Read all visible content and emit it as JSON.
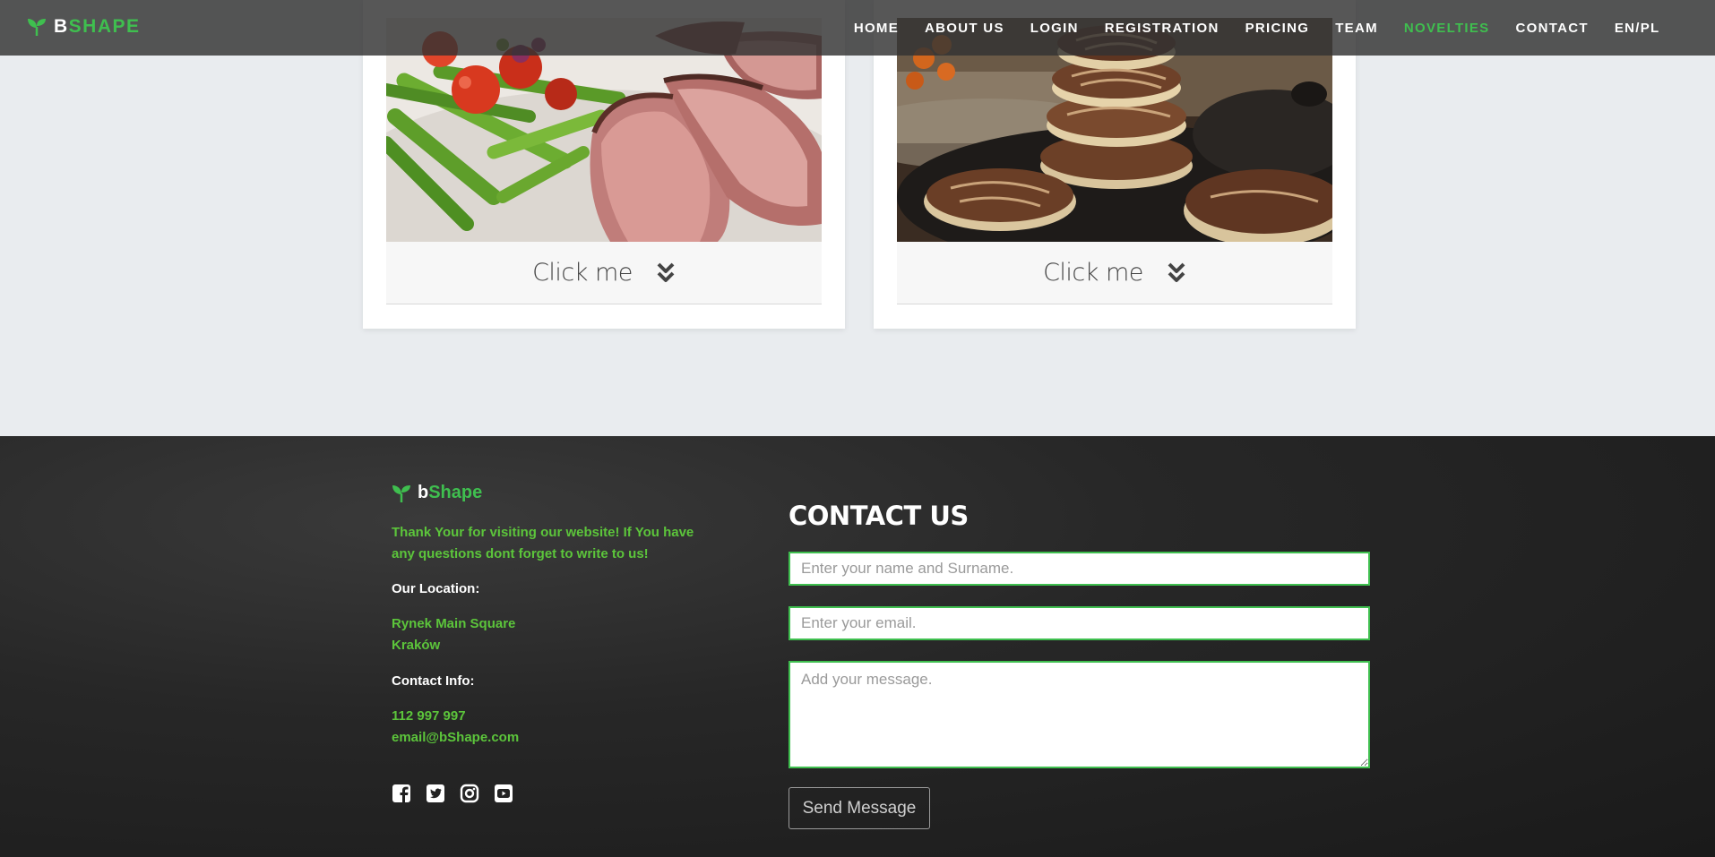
{
  "navbar": {
    "brand_first": "B",
    "brand_rest": "SHAPE",
    "items": [
      {
        "label": "HOME"
      },
      {
        "label": "ABOUT US"
      },
      {
        "label": "LOGIN"
      },
      {
        "label": "REGISTRATION"
      },
      {
        "label": "PRICING"
      },
      {
        "label": "TEAM"
      },
      {
        "label": "NOVELTIES",
        "active": true
      },
      {
        "label": "CONTACT"
      },
      {
        "label": "EN/PL"
      }
    ]
  },
  "cards": [
    {
      "image": "steak-with-asparagus-photo",
      "button_label": "Click me",
      "icon": "chevron-double-down-icon"
    },
    {
      "image": "stacked-cookies-photo",
      "button_label": "Click me",
      "icon": "chevron-double-down-icon"
    }
  ],
  "footer": {
    "brand_first": "b",
    "brand_rest": "Shape",
    "thanks_line1": "Thank Your for visiting our website! If You have",
    "thanks_line2": "any questions dont forget to write to us!",
    "location_heading": "Our Location:",
    "location_line1": "Rynek Main Square",
    "location_line2": "Kraków",
    "contact_heading": "Contact Info:",
    "phone": "112 997 997",
    "email": "email@bShape.com",
    "socials": [
      "facebook-icon",
      "twitter-icon",
      "instagram-icon",
      "youtube-icon"
    ]
  },
  "contact_form": {
    "title": "CONTACT US",
    "name_placeholder": "Enter your name and Surname.",
    "email_placeholder": "Enter your email.",
    "message_placeholder": "Add your message.",
    "send_label": "Send Message"
  },
  "colors": {
    "accent": "#3fbf4f",
    "footer_text": "#5cc53b",
    "navbar_bg": "#323232",
    "page_bg": "#e9ecef"
  }
}
